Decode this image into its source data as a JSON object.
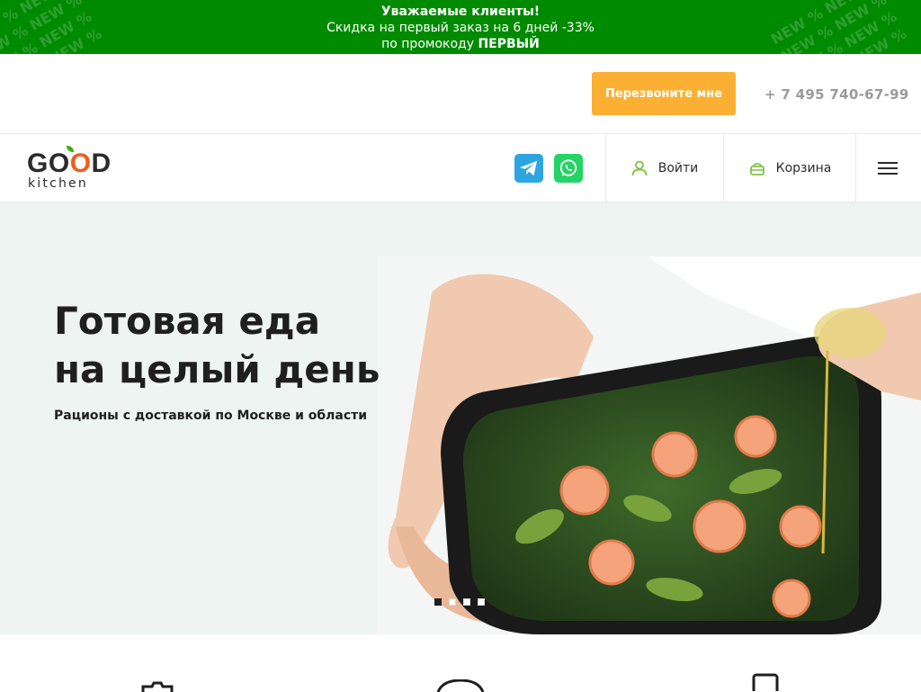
{
  "promo": {
    "title": "Уважаемые клиенты!",
    "line2": "Скидка на первый заказ на 6 дней -33%",
    "line3_prefix": "по промокоду ",
    "promo_code": "ПЕРВЫЙ",
    "pattern_text": "NEW % NEW %"
  },
  "topbar": {
    "callback_label": "Перезвоните мне",
    "phone": "+ 7 495 740-67-99"
  },
  "header": {
    "logo_word": "GOOD",
    "logo_sub": "kitchen",
    "login_label": "Войти",
    "cart_label": "Корзина"
  },
  "hero": {
    "title_line1": "Готовая еда",
    "title_line2": "на целый день",
    "subtitle": "Рационы с доставкой по Москве и области",
    "slides_count": 4,
    "active_slide": 1
  },
  "colors": {
    "promo_bg": "#008a00",
    "accent_button": "#fbb034",
    "telegram": "#2ca5e0",
    "whatsapp": "#25d366",
    "hero_bg": "#eef4f1",
    "icon_green": "#7cc243"
  },
  "icons": [
    "telegram-icon",
    "whatsapp-icon",
    "user-icon",
    "basket-icon",
    "hamburger-menu-icon"
  ]
}
